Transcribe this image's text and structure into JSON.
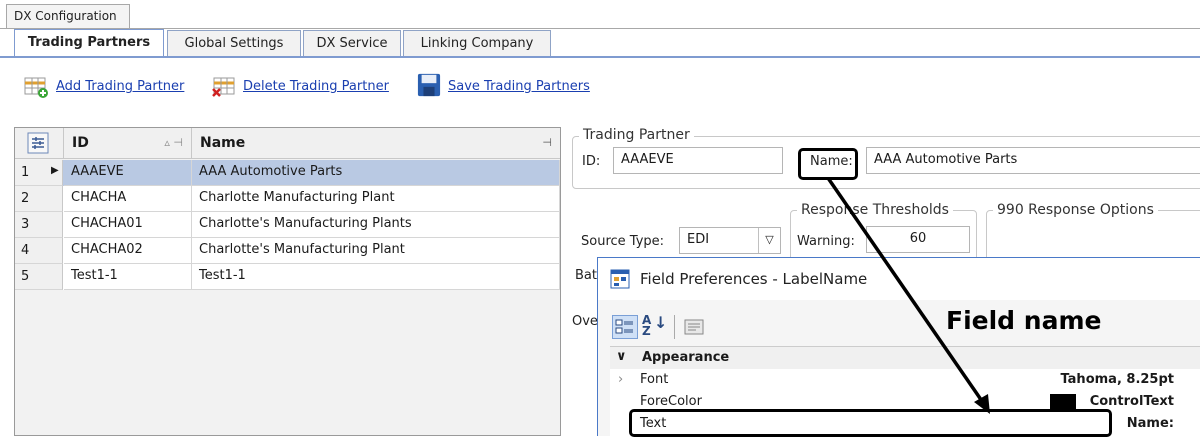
{
  "window": {
    "outer_tab": "DX Configuration"
  },
  "tabs": [
    {
      "label": "Trading Partners"
    },
    {
      "label": "Global Settings"
    },
    {
      "label": "DX Service"
    },
    {
      "label": "Linking Company"
    }
  ],
  "toolbar": {
    "add_label": "Add Trading Partner",
    "delete_label": "Delete Trading Partner",
    "save_label": "Save Trading Partners"
  },
  "grid": {
    "columns": [
      "ID",
      "Name"
    ],
    "rows": [
      {
        "num": "1",
        "id": "AAAEVE",
        "name": "AAA Automotive Parts"
      },
      {
        "num": "2",
        "id": "CHACHA",
        "name": "Charlotte Manufacturing Plant"
      },
      {
        "num": "3",
        "id": "CHACHA01",
        "name": "Charlotte's Manufacturing Plants"
      },
      {
        "num": "4",
        "id": "CHACHA02",
        "name": "Charlotte's Manufacturing Plant"
      },
      {
        "num": "5",
        "id": "Test1-1",
        "name": "Test1-1"
      }
    ]
  },
  "partner": {
    "group_label": "Trading Partner",
    "id_label": "ID:",
    "id_value": "AAAEVE",
    "name_label": "Name:",
    "name_value": "AAA Automotive Parts"
  },
  "source": {
    "label": "Source Type:",
    "value": "EDI"
  },
  "thresholds": {
    "group_label": "Response Thresholds",
    "warning_label": "Warning:",
    "warning_value": "60"
  },
  "response_options": {
    "group_label": "990 Response Options"
  },
  "partial_labels": {
    "bat": "Bat",
    "ove": "Ove"
  },
  "dialog": {
    "title": "Field Preferences - LabelName",
    "category": "Appearance",
    "properties": [
      {
        "name": "Font",
        "value": "Tahoma, 8.25pt"
      },
      {
        "name": "ForeColor",
        "value": "ControlText"
      },
      {
        "name": "Text",
        "value": "Name:"
      }
    ]
  },
  "annotation": {
    "text": "Field name"
  },
  "colors": {
    "accent": "#7f9bd0",
    "selection": "#b9c9e3",
    "link": "#1a3fb0"
  }
}
